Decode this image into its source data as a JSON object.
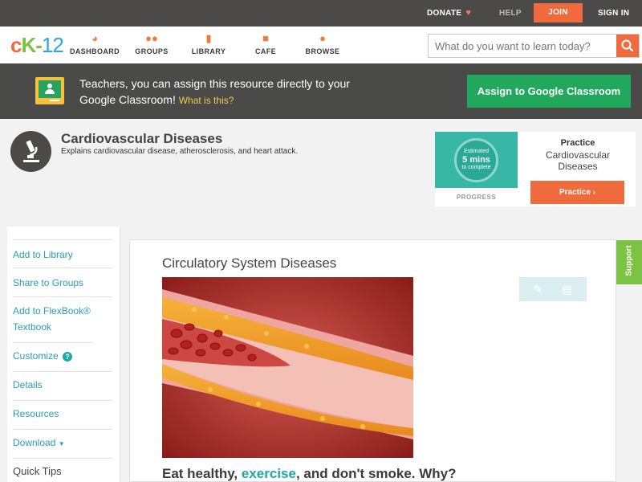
{
  "topbar": {
    "donate": "DONATE",
    "help": "HELP",
    "join": "JOIN",
    "signin": "SIGN IN"
  },
  "nav": {
    "logo": {
      "c": "c",
      "k": "K",
      "dash": "-",
      "n": "12"
    },
    "items": [
      {
        "label": "DASHBOARD",
        "icon": "dashboard-icon"
      },
      {
        "label": "GROUPS",
        "icon": "groups-icon"
      },
      {
        "label": "LIBRARY",
        "icon": "library-icon"
      },
      {
        "label": "CAFE",
        "icon": "cafe-icon"
      },
      {
        "label": "BROWSE",
        "icon": "browse-icon"
      }
    ],
    "search_placeholder": "What do you want to learn today?"
  },
  "banner": {
    "text": "Teachers, you can assign this resource directly to your Google Classroom!",
    "what_link": "What is this?",
    "assign_button": "Assign to Google Classroom"
  },
  "concept": {
    "title": "Cardiovascular Diseases",
    "subtitle": "Explains cardiovascular disease, atherosclerosis, and heart attack."
  },
  "practice": {
    "estimate_line1": "Estimated",
    "estimate_mins": "5 mins",
    "estimate_line3": "to complete",
    "progress_label": "PROGRESS",
    "heading": "Practice",
    "name": "Cardiovascular Diseases",
    "button": "Practice"
  },
  "sidebar": {
    "items": [
      {
        "label": "Add to Library"
      },
      {
        "label": "Share to Groups"
      },
      {
        "label": "Add to FlexBook® Textbook"
      },
      {
        "label": "Customize"
      },
      {
        "label": "Details"
      },
      {
        "label": "Resources"
      },
      {
        "label": "Download"
      }
    ],
    "quick_tips": "Quick Tips"
  },
  "main": {
    "section_title": "Circulatory System Diseases",
    "question_part1": "Eat healthy, ",
    "question_keyword": "exercise",
    "question_part2": ", and don't smoke. Why?"
  },
  "support_tab": "Support",
  "colors": {
    "accent_orange": "#ef6b3e",
    "green": "#21a85d",
    "teal": "#2a9eb3",
    "banner_bg": "#4a4a48"
  }
}
